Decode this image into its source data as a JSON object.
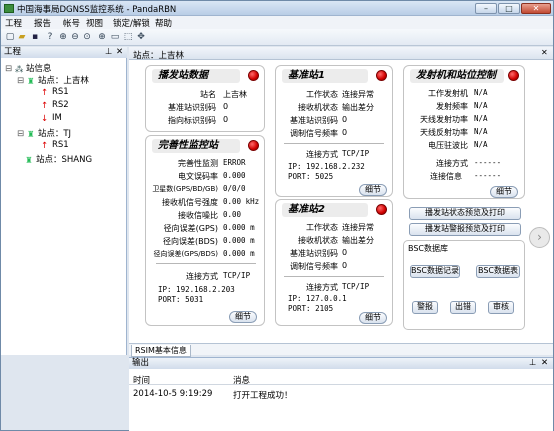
{
  "window": {
    "title": "中国海事局DGNSS监控系统 - PandaRBN",
    "min": "–",
    "max": "□",
    "close": "✕"
  },
  "menu": [
    "工程",
    "报告",
    "帐号",
    "视图",
    "锁定/解锁",
    "帮助"
  ],
  "toolbar": [
    "new-icon",
    "open-icon",
    "save-icon",
    "help-icon",
    "zoom-in-icon",
    "zoom-out-icon",
    "zoom-reset-icon",
    "crosshair-icon",
    "rect-icon",
    "select-icon",
    "move-icon"
  ],
  "project": {
    "title": "工程",
    "pin": "📌",
    "close": "✕",
    "tree": [
      {
        "label": "站信息",
        "level": 0,
        "icon": "network-icon"
      },
      {
        "label": "站点：上吉林",
        "level": 1,
        "icon": "station-icon"
      },
      {
        "label": "RS1",
        "level": 2,
        "icon": "arrow-up-red-icon"
      },
      {
        "label": "RS2",
        "level": 2,
        "icon": "arrow-up-red-icon"
      },
      {
        "label": "IM",
        "level": 2,
        "icon": "arrow-down-red-icon"
      },
      {
        "label": "站点：TJ",
        "level": 1,
        "icon": "station-icon"
      },
      {
        "label": "RS1",
        "level": 2,
        "icon": "arrow-up-red-icon"
      },
      {
        "label": "站点：SHANG",
        "level": 1,
        "icon": "station-icon"
      }
    ]
  },
  "main": {
    "tab": "站点：上吉林",
    "close": "✕",
    "bottom_tab": "RSIM基本信息"
  },
  "broadcast": {
    "title": "播发站数据",
    "rows": [
      {
        "label": "站名",
        "value": "上吉林"
      },
      {
        "label": "基准站识别码",
        "value": "0"
      },
      {
        "label": "指向标识别码",
        "value": "0"
      }
    ]
  },
  "integrity": {
    "title": "完善性监控站",
    "rows": [
      {
        "label": "完善性监测",
        "value": "ERROR"
      },
      {
        "label": "电文误码率",
        "value": "0.000"
      },
      {
        "label": "卫星数(GPS/BD/GB)",
        "value": "0/0/0"
      },
      {
        "label": "接收机信号强度",
        "value": "0.00 kHz"
      },
      {
        "label": "接收信噪比",
        "value": "0.00"
      },
      {
        "label": "径向误差(GPS)",
        "value": "0.000 m"
      },
      {
        "label": "径向误差(BDS)",
        "value": "0.000 m"
      },
      {
        "label": "径向误差(GPS/BDS)",
        "value": "0.000 m"
      }
    ],
    "conn_label": "连接方式",
    "conn_value": "TCP/IP",
    "ip": "IP: 192.168.2.203",
    "port": "PORT: 5031",
    "detail": "细节"
  },
  "ref1": {
    "title": "基准站1",
    "rows": [
      {
        "label": "工作状态",
        "value": "连接异常"
      },
      {
        "label": "接收机状态",
        "value": "输出差分"
      },
      {
        "label": "基准站识别码",
        "value": "0"
      },
      {
        "label": "调制信号频率",
        "value": "0"
      }
    ],
    "conn_label": "连接方式",
    "conn_value": "TCP/IP",
    "ip": "IP: 192.168.2.232",
    "port": "PORT: 5025",
    "detail": "细节"
  },
  "ref2": {
    "title": "基准站2",
    "rows": [
      {
        "label": "工作状态",
        "value": "连接异常"
      },
      {
        "label": "接收机状态",
        "value": "输出差分"
      },
      {
        "label": "基准站识别码",
        "value": "0"
      },
      {
        "label": "调制信号频率",
        "value": "0"
      }
    ],
    "conn_label": "连接方式",
    "conn_value": "TCP/IP",
    "ip": "IP: 127.0.0.1",
    "port": "PORT: 2105",
    "detail": "细节"
  },
  "transmitter": {
    "title": "发射机和站位控制",
    "rows": [
      {
        "label": "工作发射机",
        "value": "N/A"
      },
      {
        "label": "发射频率",
        "value": "N/A"
      },
      {
        "label": "天线发射功率",
        "value": "N/A"
      },
      {
        "label": "天线反射功率",
        "value": "N/A"
      },
      {
        "label": "电压驻波比",
        "value": "N/A"
      }
    ],
    "conn_label": "连接方式",
    "conn_value": "------",
    "info_label": "连接信息",
    "info_value": "------",
    "detail": "细节"
  },
  "actions": {
    "status_preview": "播发站状态预览及打印",
    "alarm_preview": "播发站警报预览及打印"
  },
  "bsc": {
    "title": "BSC数据库",
    "record": "BSC数据记录",
    "table": "BSC数据表",
    "alarm": "警报",
    "error": "出错",
    "audit": "审核"
  },
  "output": {
    "title": "输出",
    "pin": "📌",
    "close": "✕",
    "col_time": "时间",
    "col_msg": "消息",
    "rows": [
      {
        "time": "2014-10-5 9:19:29",
        "msg": "打开工程成功！"
      }
    ]
  },
  "colors": {
    "led": "#d10000",
    "accent": "#3d6fa8"
  }
}
